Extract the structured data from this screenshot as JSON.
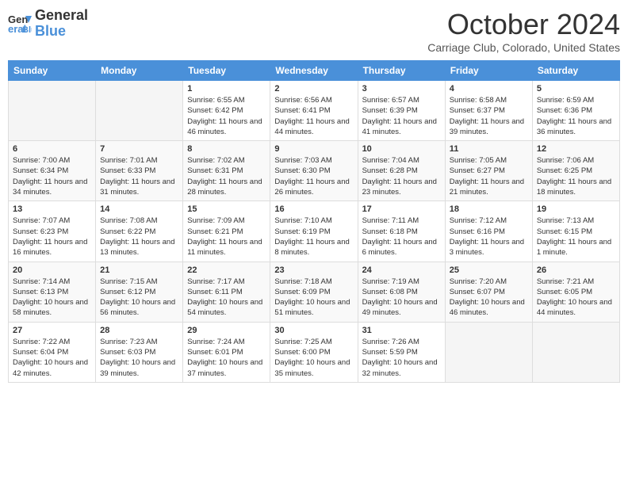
{
  "logo": {
    "general": "General",
    "blue": "Blue"
  },
  "title": "October 2024",
  "subtitle": "Carriage Club, Colorado, United States",
  "days_of_week": [
    "Sunday",
    "Monday",
    "Tuesday",
    "Wednesday",
    "Thursday",
    "Friday",
    "Saturday"
  ],
  "weeks": [
    [
      {
        "day": "",
        "info": ""
      },
      {
        "day": "",
        "info": ""
      },
      {
        "day": "1",
        "info": "Sunrise: 6:55 AM\nSunset: 6:42 PM\nDaylight: 11 hours and 46 minutes."
      },
      {
        "day": "2",
        "info": "Sunrise: 6:56 AM\nSunset: 6:41 PM\nDaylight: 11 hours and 44 minutes."
      },
      {
        "day": "3",
        "info": "Sunrise: 6:57 AM\nSunset: 6:39 PM\nDaylight: 11 hours and 41 minutes."
      },
      {
        "day": "4",
        "info": "Sunrise: 6:58 AM\nSunset: 6:37 PM\nDaylight: 11 hours and 39 minutes."
      },
      {
        "day": "5",
        "info": "Sunrise: 6:59 AM\nSunset: 6:36 PM\nDaylight: 11 hours and 36 minutes."
      }
    ],
    [
      {
        "day": "6",
        "info": "Sunrise: 7:00 AM\nSunset: 6:34 PM\nDaylight: 11 hours and 34 minutes."
      },
      {
        "day": "7",
        "info": "Sunrise: 7:01 AM\nSunset: 6:33 PM\nDaylight: 11 hours and 31 minutes."
      },
      {
        "day": "8",
        "info": "Sunrise: 7:02 AM\nSunset: 6:31 PM\nDaylight: 11 hours and 28 minutes."
      },
      {
        "day": "9",
        "info": "Sunrise: 7:03 AM\nSunset: 6:30 PM\nDaylight: 11 hours and 26 minutes."
      },
      {
        "day": "10",
        "info": "Sunrise: 7:04 AM\nSunset: 6:28 PM\nDaylight: 11 hours and 23 minutes."
      },
      {
        "day": "11",
        "info": "Sunrise: 7:05 AM\nSunset: 6:27 PM\nDaylight: 11 hours and 21 minutes."
      },
      {
        "day": "12",
        "info": "Sunrise: 7:06 AM\nSunset: 6:25 PM\nDaylight: 11 hours and 18 minutes."
      }
    ],
    [
      {
        "day": "13",
        "info": "Sunrise: 7:07 AM\nSunset: 6:23 PM\nDaylight: 11 hours and 16 minutes."
      },
      {
        "day": "14",
        "info": "Sunrise: 7:08 AM\nSunset: 6:22 PM\nDaylight: 11 hours and 13 minutes."
      },
      {
        "day": "15",
        "info": "Sunrise: 7:09 AM\nSunset: 6:21 PM\nDaylight: 11 hours and 11 minutes."
      },
      {
        "day": "16",
        "info": "Sunrise: 7:10 AM\nSunset: 6:19 PM\nDaylight: 11 hours and 8 minutes."
      },
      {
        "day": "17",
        "info": "Sunrise: 7:11 AM\nSunset: 6:18 PM\nDaylight: 11 hours and 6 minutes."
      },
      {
        "day": "18",
        "info": "Sunrise: 7:12 AM\nSunset: 6:16 PM\nDaylight: 11 hours and 3 minutes."
      },
      {
        "day": "19",
        "info": "Sunrise: 7:13 AM\nSunset: 6:15 PM\nDaylight: 11 hours and 1 minute."
      }
    ],
    [
      {
        "day": "20",
        "info": "Sunrise: 7:14 AM\nSunset: 6:13 PM\nDaylight: 10 hours and 58 minutes."
      },
      {
        "day": "21",
        "info": "Sunrise: 7:15 AM\nSunset: 6:12 PM\nDaylight: 10 hours and 56 minutes."
      },
      {
        "day": "22",
        "info": "Sunrise: 7:17 AM\nSunset: 6:11 PM\nDaylight: 10 hours and 54 minutes."
      },
      {
        "day": "23",
        "info": "Sunrise: 7:18 AM\nSunset: 6:09 PM\nDaylight: 10 hours and 51 minutes."
      },
      {
        "day": "24",
        "info": "Sunrise: 7:19 AM\nSunset: 6:08 PM\nDaylight: 10 hours and 49 minutes."
      },
      {
        "day": "25",
        "info": "Sunrise: 7:20 AM\nSunset: 6:07 PM\nDaylight: 10 hours and 46 minutes."
      },
      {
        "day": "26",
        "info": "Sunrise: 7:21 AM\nSunset: 6:05 PM\nDaylight: 10 hours and 44 minutes."
      }
    ],
    [
      {
        "day": "27",
        "info": "Sunrise: 7:22 AM\nSunset: 6:04 PM\nDaylight: 10 hours and 42 minutes."
      },
      {
        "day": "28",
        "info": "Sunrise: 7:23 AM\nSunset: 6:03 PM\nDaylight: 10 hours and 39 minutes."
      },
      {
        "day": "29",
        "info": "Sunrise: 7:24 AM\nSunset: 6:01 PM\nDaylight: 10 hours and 37 minutes."
      },
      {
        "day": "30",
        "info": "Sunrise: 7:25 AM\nSunset: 6:00 PM\nDaylight: 10 hours and 35 minutes."
      },
      {
        "day": "31",
        "info": "Sunrise: 7:26 AM\nSunset: 5:59 PM\nDaylight: 10 hours and 32 minutes."
      },
      {
        "day": "",
        "info": ""
      },
      {
        "day": "",
        "info": ""
      }
    ]
  ]
}
